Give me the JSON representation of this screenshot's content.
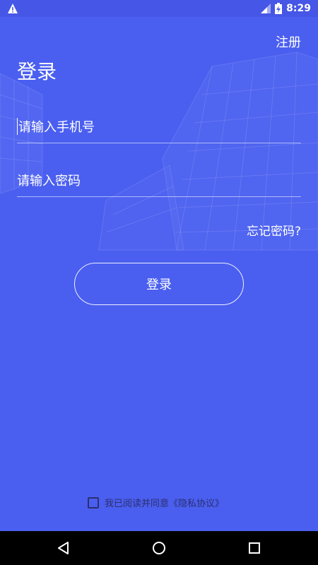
{
  "status_bar": {
    "time": "8:29",
    "icons": [
      "warning-icon",
      "signal-icon",
      "battery-charging-icon"
    ]
  },
  "header": {
    "register_label": "注册",
    "title": "登录"
  },
  "form": {
    "phone": {
      "placeholder": "请输入手机号",
      "value": ""
    },
    "password": {
      "placeholder": "请输入密码",
      "value": ""
    },
    "forgot_label": "忘记密码?",
    "login_label": "登录"
  },
  "agreement": {
    "text": "我已阅读并同意",
    "link": "《隐私协议》",
    "checked": false
  },
  "nav_bar": {
    "buttons": [
      "back-icon",
      "home-icon",
      "recent-apps-icon"
    ]
  },
  "colors": {
    "background": "#4a5ff0",
    "status_bar": "#4656e6",
    "agreement_text": "#2c2f6e",
    "nav_bar": "#000000"
  }
}
